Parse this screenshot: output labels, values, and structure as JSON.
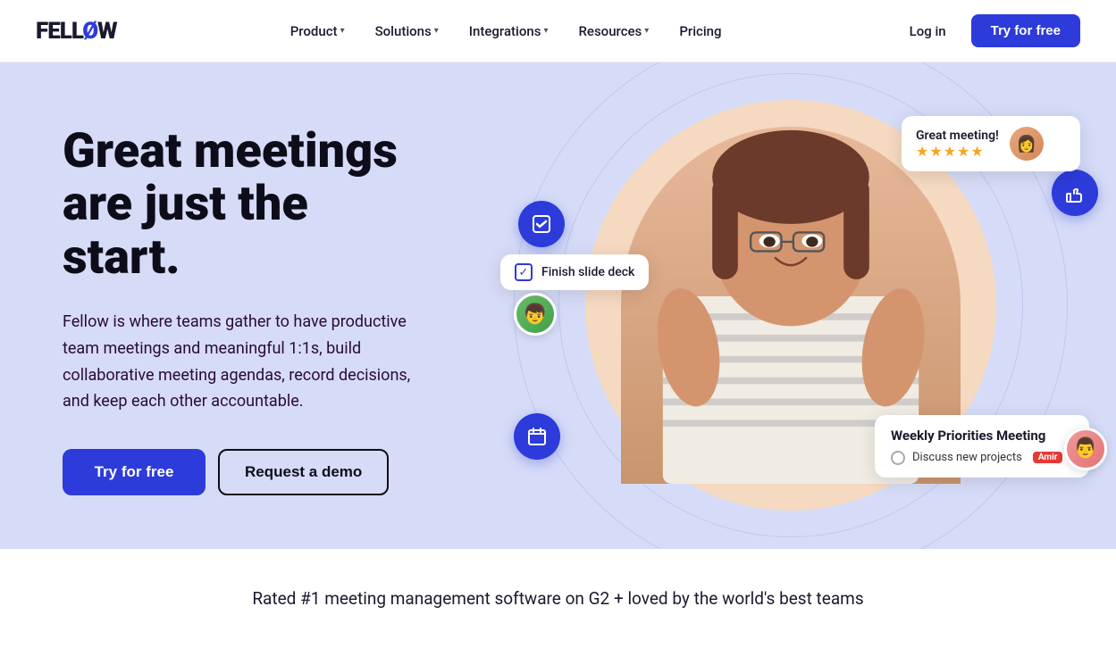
{
  "logo": {
    "text_before": "FELL",
    "slash": "Ø",
    "text_after": "W"
  },
  "nav": {
    "links": [
      {
        "label": "Product",
        "has_dropdown": true
      },
      {
        "label": "Solutions",
        "has_dropdown": true
      },
      {
        "label": "Integrations",
        "has_dropdown": true
      },
      {
        "label": "Resources",
        "has_dropdown": true
      },
      {
        "label": "Pricing",
        "has_dropdown": false
      }
    ],
    "login_label": "Log in",
    "try_label": "Try for free"
  },
  "hero": {
    "title": "Great meetings are just the start.",
    "description": "Fellow is where teams gather to have productive team meetings and meaningful 1:1s, build collaborative meeting agendas, record decisions, and keep each other accountable.",
    "try_btn": "Try for free",
    "demo_btn": "Request a demo"
  },
  "floating": {
    "great_meeting": {
      "title": "Great meeting!",
      "stars": "★★★★★"
    },
    "task": {
      "label": "Finish slide deck"
    },
    "weekly_meeting": {
      "title": "Weekly Priorities Meeting",
      "item": "Discuss new projects",
      "tag": "Amir"
    }
  },
  "bottom_banner": {
    "text": "Rated #1 meeting management software on G2 + loved by the world's best teams"
  },
  "colors": {
    "accent": "#2d3bdb",
    "hero_bg": "#d6dcf7",
    "circle_bg": "#f5d9c0"
  }
}
